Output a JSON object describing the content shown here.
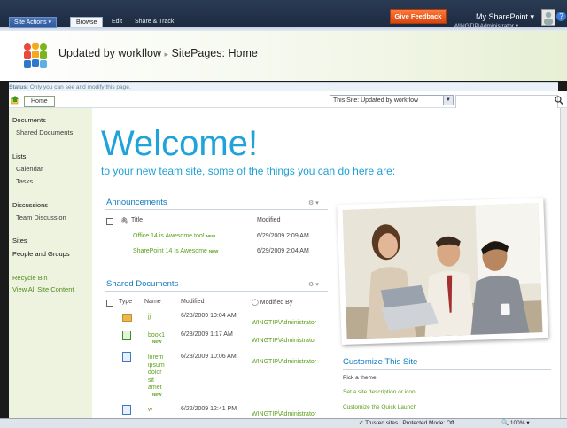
{
  "ribbon": {
    "site_actions": "Site Actions",
    "tabs": [
      "Browse",
      "Edit",
      "Share & Track"
    ],
    "feedback": "Give Feedback",
    "mysharepoint": "My SharePoint",
    "user": "WINGTIP\\Administrator"
  },
  "title": {
    "site": "Updated by workflow",
    "separator": "▸",
    "page": "SitePages: Home"
  },
  "status": {
    "label": "Status:",
    "text": "Only you can see and modify this page."
  },
  "nav": {
    "home_tab": "Home",
    "search_scope": "This Site: Updated by workflow",
    "search_placeholder": ""
  },
  "leftnav": {
    "documents": "Documents",
    "shared_documents": "Shared Documents",
    "lists": "Lists",
    "calendar": "Calendar",
    "tasks": "Tasks",
    "discussions": "Discussions",
    "team_discussion": "Team Discussion",
    "sites": "Sites",
    "people_groups": "People and Groups",
    "recycle_bin": "Recycle Bin",
    "view_all": "View All Site Content"
  },
  "main": {
    "welcome": "Welcome!",
    "subtitle": "to your new team site, some of the things you can do here are:",
    "announcements": {
      "title": "Announcements",
      "col_title": "Title",
      "col_modified": "Modified",
      "rows": [
        {
          "title": "Office 14 is Awesome too!",
          "badge": "NEW",
          "modified": "6/29/2009 2:09 AM"
        },
        {
          "title": "SharePoint 14 Is Awesome",
          "badge": "NEW",
          "modified": "6/29/2009 2:04 AM"
        }
      ]
    },
    "shared_docs": {
      "title": "Shared Documents",
      "col_type": "Type",
      "col_name": "Name",
      "col_modified": "Modified",
      "col_modified_by": "Modified By",
      "rows": [
        {
          "name": "jj",
          "badge": "",
          "modified": "6/28/2009 10:04 AM",
          "by": "WINGTIP\\Administrator"
        },
        {
          "name": "book1",
          "badge": "NEW",
          "modified": "6/28/2009 1:17 AM",
          "by": "WINGTIP\\Administrator"
        },
        {
          "name_lines": [
            "lorem",
            "ipsum",
            "dolor",
            "sit",
            "amet"
          ],
          "badge": "NEW",
          "modified": "6/28/2009 10:06 AM",
          "by": "WINGTIP\\Administrator"
        },
        {
          "name": "w",
          "badge": "",
          "modified": "6/22/2009 12:41 PM",
          "by": "WINGTIP\\Administrator"
        }
      ]
    },
    "customize": {
      "title": "Customize This Site",
      "links": [
        "Pick a theme",
        "Set a site description or icon",
        "Customize the Quick Launch"
      ]
    }
  },
  "iebar": {
    "zone": "Trusted sites | Protected Mode: Off",
    "zoom": "100%"
  }
}
